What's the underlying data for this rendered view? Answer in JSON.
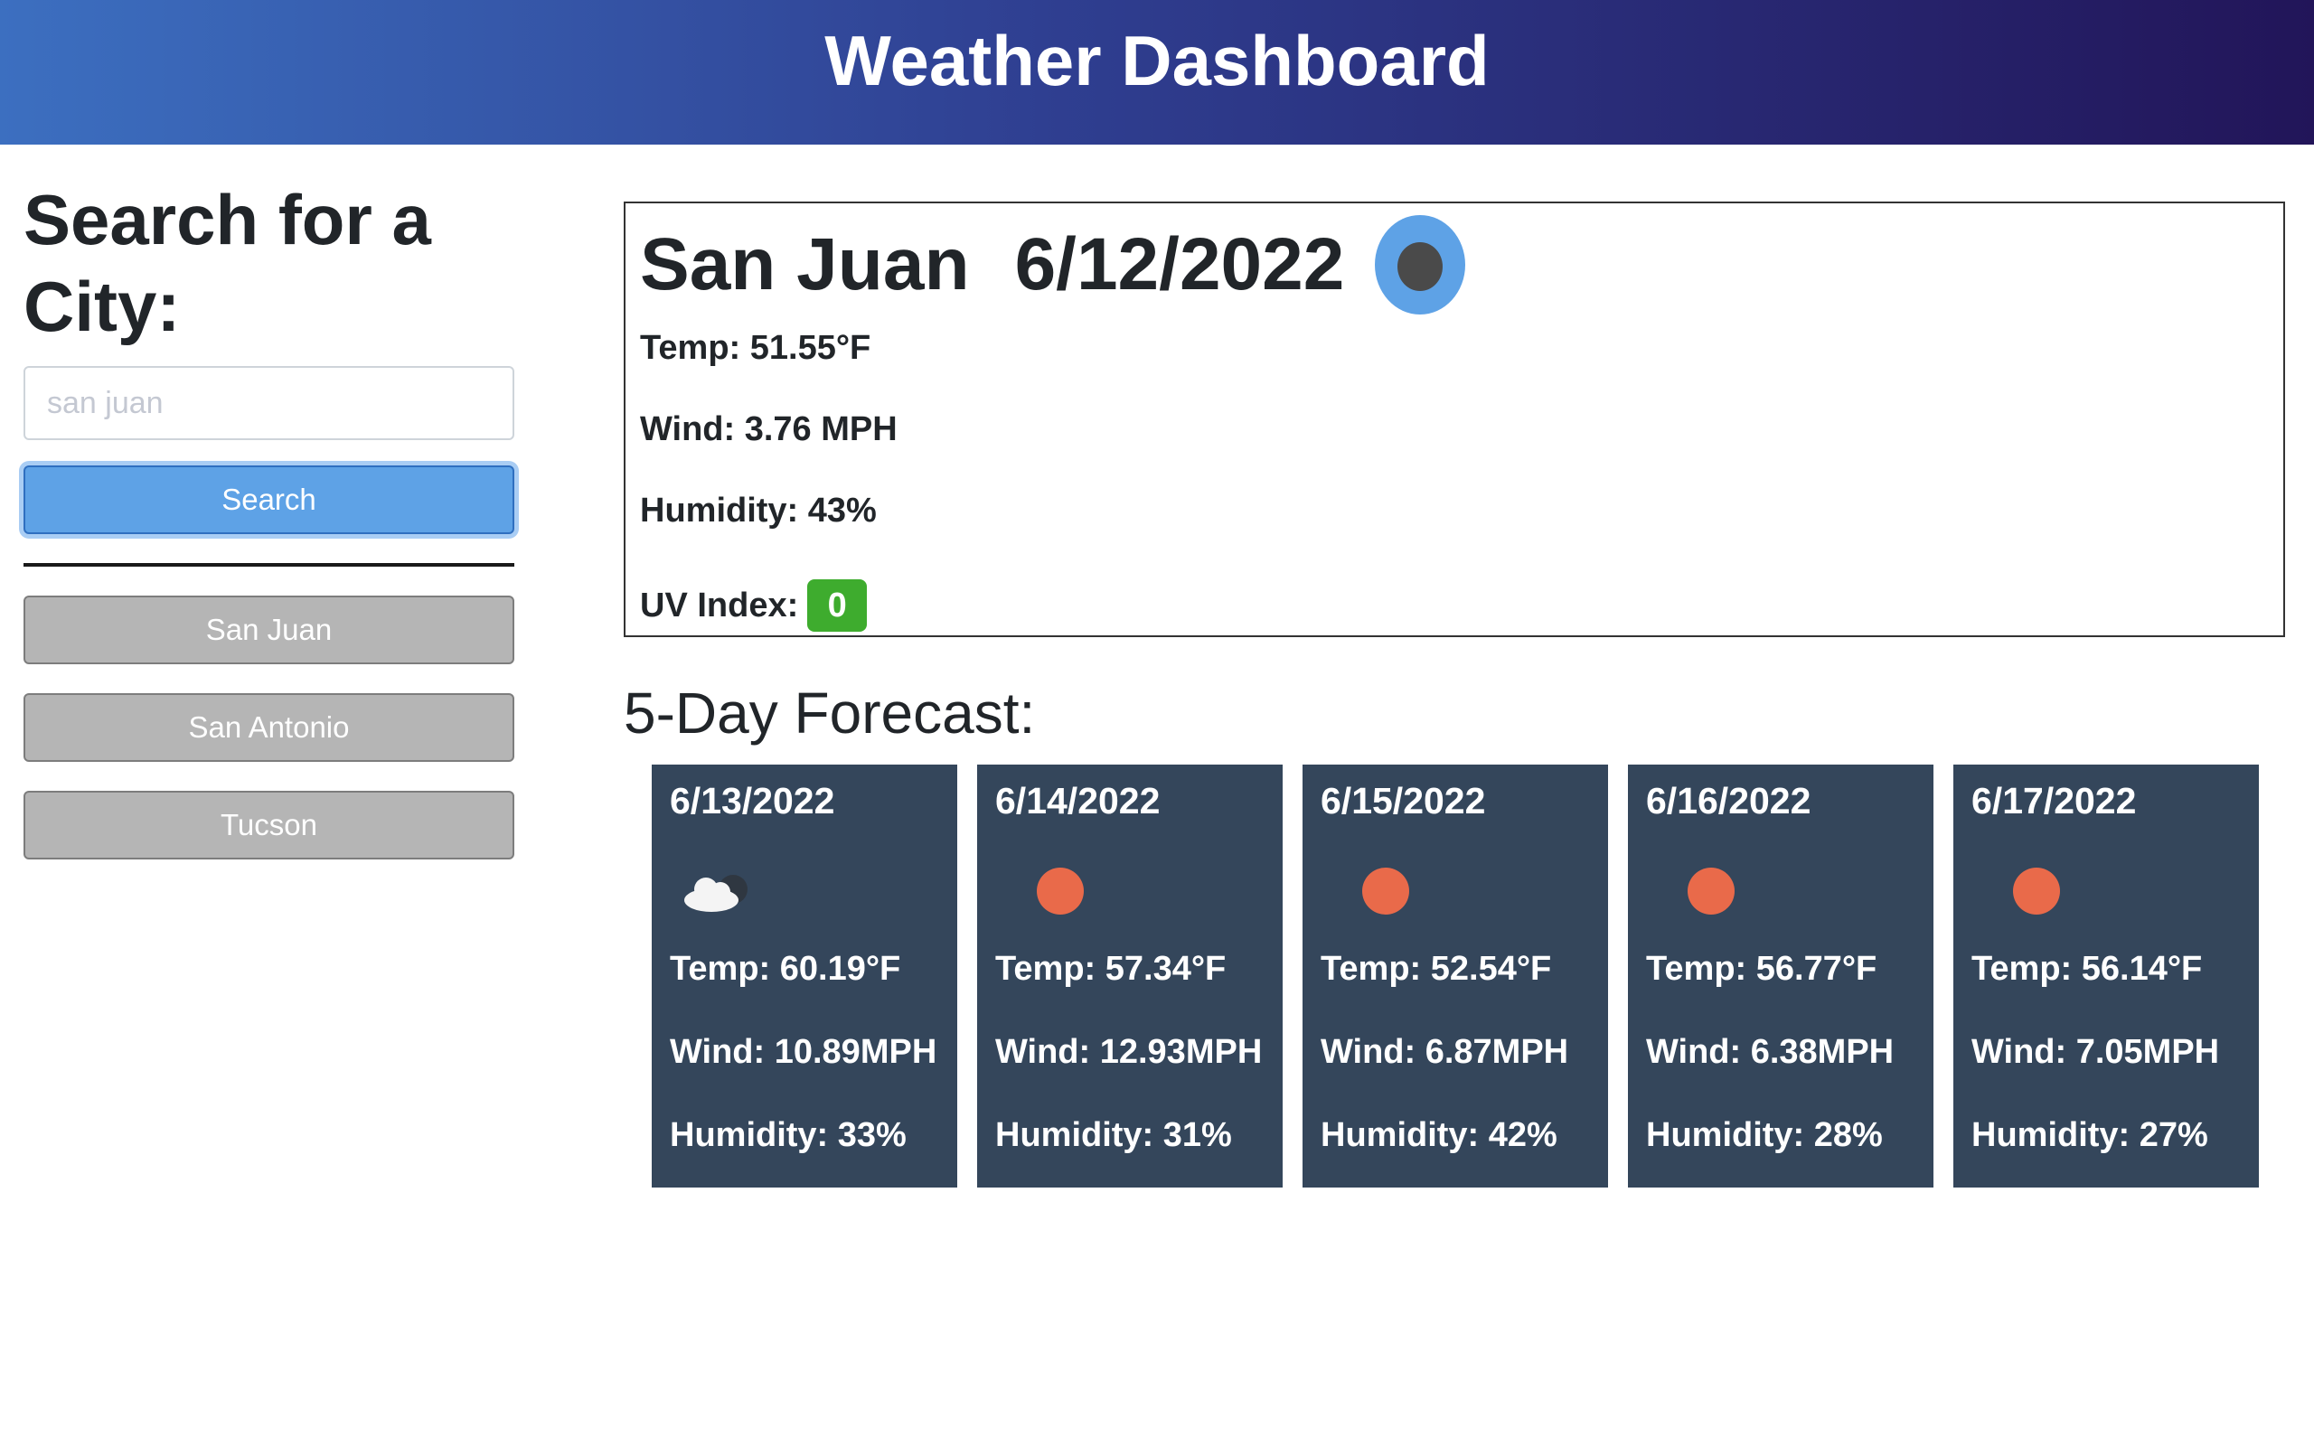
{
  "header": {
    "title": "Weather Dashboard"
  },
  "sidebar": {
    "search_title": "Search for a City:",
    "search_input": {
      "value": "",
      "placeholder": "san juan"
    },
    "search_button": "Search",
    "history": [
      "San Juan",
      "San Antonio",
      "Tucson"
    ]
  },
  "current": {
    "city": "San Juan",
    "date": "6/12/2022",
    "icon": "weather-icon",
    "temp": "Temp: 51.55°F",
    "wind": "Wind: 3.76 MPH",
    "humidity": "Humidity: 43%",
    "uv_label": "UV Index:",
    "uv_value": "0",
    "uv_color": "#3eac2e"
  },
  "forecast": {
    "title": "5-Day Forecast:",
    "days": [
      {
        "date": "6/13/2022",
        "icon": "cloud-icon",
        "temp": "Temp: 60.19°F",
        "wind": "Wind: 10.89MPH",
        "humidity": "Humidity: 33%"
      },
      {
        "date": "6/14/2022",
        "icon": "sun-icon",
        "temp": "Temp: 57.34°F",
        "wind": "Wind: 12.93MPH",
        "humidity": "Humidity: 31%"
      },
      {
        "date": "6/15/2022",
        "icon": "sun-icon",
        "temp": "Temp: 52.54°F",
        "wind": "Wind: 6.87MPH",
        "humidity": "Humidity: 42%"
      },
      {
        "date": "6/16/2022",
        "icon": "sun-icon",
        "temp": "Temp: 56.77°F",
        "wind": "Wind: 6.38MPH",
        "humidity": "Humidity: 28%"
      },
      {
        "date": "6/17/2022",
        "icon": "sun-icon",
        "temp": "Temp: 56.14°F",
        "wind": "Wind: 7.05MPH",
        "humidity": "Humidity: 27%"
      }
    ]
  }
}
